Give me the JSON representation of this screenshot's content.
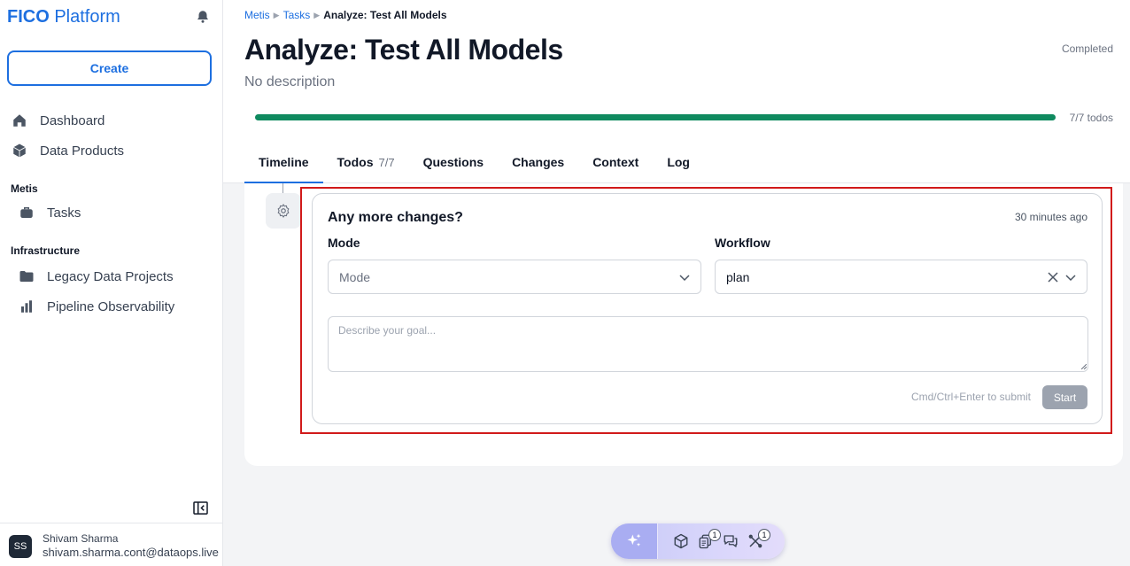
{
  "sidebar": {
    "brand_bold": "FICO",
    "brand_rest": " Platform",
    "create_label": "Create",
    "items": [
      {
        "label": "Dashboard",
        "icon": "home-icon"
      },
      {
        "label": "Data Products",
        "icon": "cube-icon"
      }
    ],
    "sections": [
      {
        "label": "Metis",
        "items": [
          {
            "label": "Tasks",
            "icon": "briefcase-icon"
          }
        ]
      },
      {
        "label": "Infrastructure",
        "items": [
          {
            "label": "Legacy Data Projects",
            "icon": "folder-icon"
          },
          {
            "label": "Pipeline Observability",
            "icon": "bar-chart-icon"
          }
        ]
      }
    ],
    "user": {
      "initials": "SS",
      "name": "Shivam Sharma",
      "email": "shivam.sharma.cont@dataops.live"
    }
  },
  "header": {
    "breadcrumb": [
      "Metis",
      "Tasks",
      "Analyze: Test All Models"
    ],
    "title": "Analyze: Test All Models",
    "description": "No description",
    "status": "Completed",
    "progress_fraction": 1.0,
    "progress_label": "7/7 todos",
    "tabs": [
      {
        "label": "Timeline",
        "count": "",
        "active": true
      },
      {
        "label": "Todos",
        "count": "7/7",
        "active": false
      },
      {
        "label": "Questions",
        "count": "",
        "active": false
      },
      {
        "label": "Changes",
        "count": "",
        "active": false
      },
      {
        "label": "Context",
        "count": "",
        "active": false
      },
      {
        "label": "Log",
        "count": "",
        "active": false
      }
    ]
  },
  "form": {
    "title": "Any more changes?",
    "time": "30 minutes ago",
    "mode_label": "Mode",
    "mode_placeholder": "Mode",
    "workflow_label": "Workflow",
    "workflow_value": "plan",
    "goal_placeholder": "Describe your goal...",
    "hint": "Cmd/Ctrl+Enter to submit",
    "start_label": "Start"
  },
  "toolbar": {
    "badges": {
      "docs": "1",
      "tools": "1"
    }
  },
  "colors": {
    "brand": "#1d6fe0",
    "progress": "#0f8a5f",
    "highlight": "#d11a1a"
  }
}
